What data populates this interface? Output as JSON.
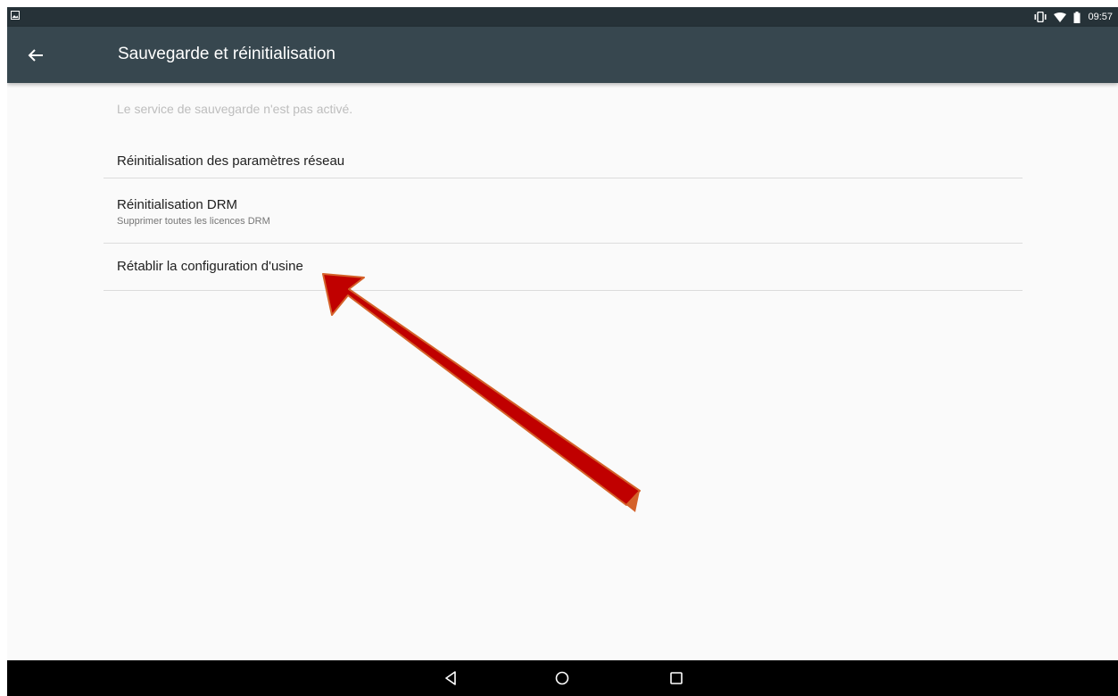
{
  "status_bar": {
    "time": "09:57",
    "icons": [
      "image-notification-icon",
      "vibrate-icon",
      "wifi-icon",
      "battery-icon"
    ]
  },
  "toolbar": {
    "back_icon": "arrow-back-icon",
    "title": "Sauvegarde et réinitialisation",
    "color": "#37474f"
  },
  "settings": {
    "info_text": "Le service de sauvegarde n'est pas activé.",
    "items": [
      {
        "title": "Réinitialisation des paramètres réseau",
        "summary": ""
      },
      {
        "title": "Réinitialisation DRM",
        "summary": "Supprimer toutes les licences DRM"
      },
      {
        "title": "Rétablir la configuration d'usine",
        "summary": ""
      }
    ]
  },
  "nav_bar": {
    "buttons": [
      "back-triangle-icon",
      "home-circle-icon",
      "recents-square-icon"
    ]
  },
  "annotation": {
    "arrow_color": "#c00000",
    "arrow_outline": "#d4622a"
  }
}
